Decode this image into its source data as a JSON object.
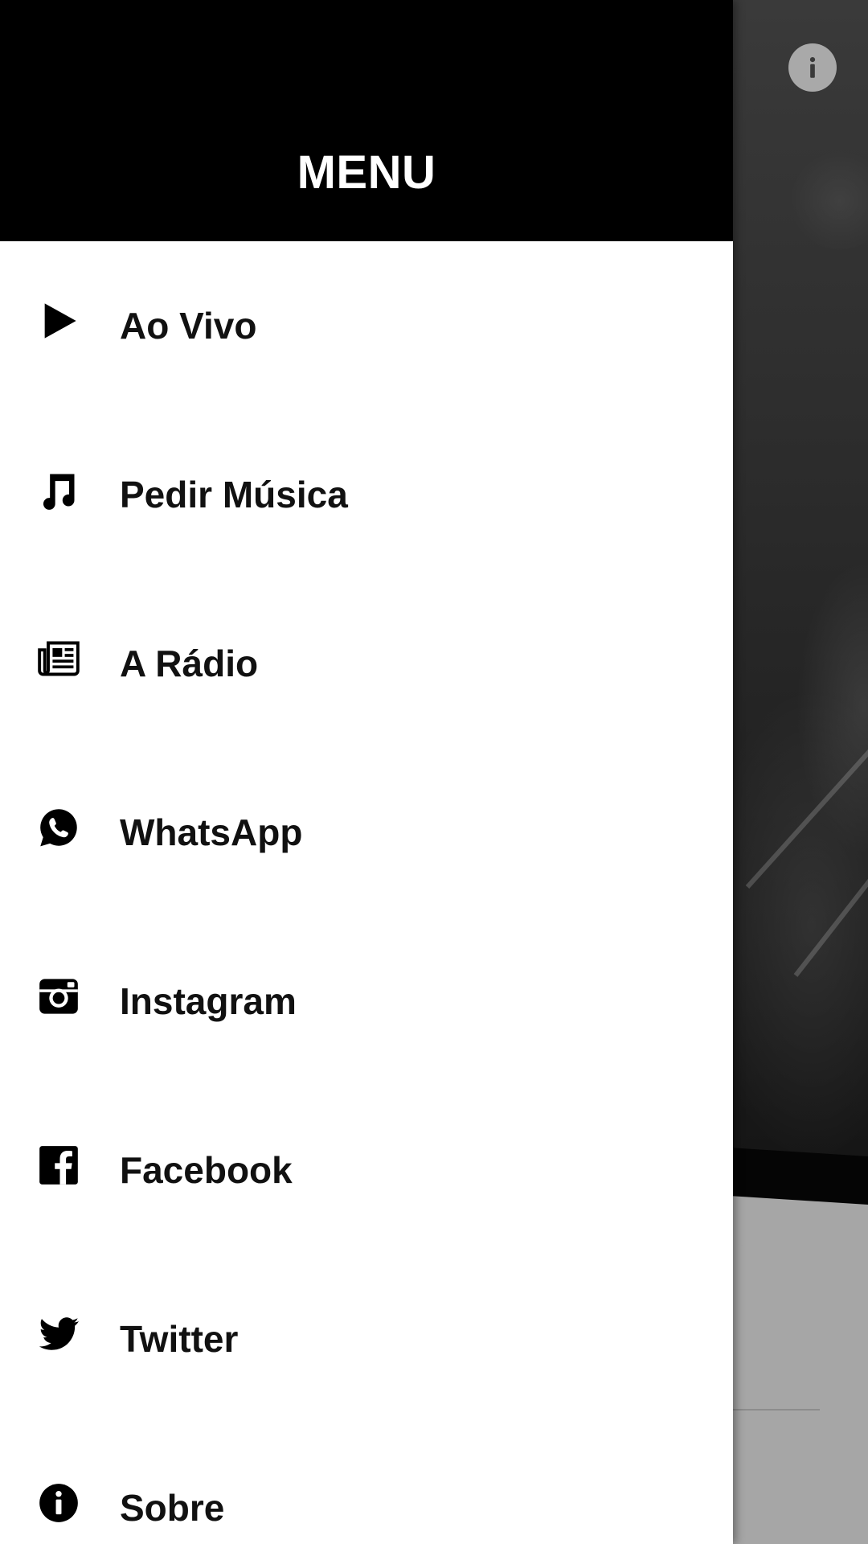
{
  "drawer": {
    "title": "MENU",
    "items": [
      {
        "label": "Ao Vivo",
        "icon": "play-icon"
      },
      {
        "label": "Pedir Música",
        "icon": "music-note-icon"
      },
      {
        "label": "A Rádio",
        "icon": "newspaper-icon"
      },
      {
        "label": "WhatsApp",
        "icon": "whatsapp-icon"
      },
      {
        "label": "Instagram",
        "icon": "instagram-icon"
      },
      {
        "label": "Facebook",
        "icon": "facebook-icon"
      },
      {
        "label": "Twitter",
        "icon": "twitter-icon"
      },
      {
        "label": "Sobre",
        "icon": "info-icon"
      }
    ]
  },
  "background": {
    "info_button_icon": "info-icon"
  },
  "colors": {
    "drawer_header": "#000000",
    "drawer_body": "#ffffff",
    "text": "#111111"
  }
}
